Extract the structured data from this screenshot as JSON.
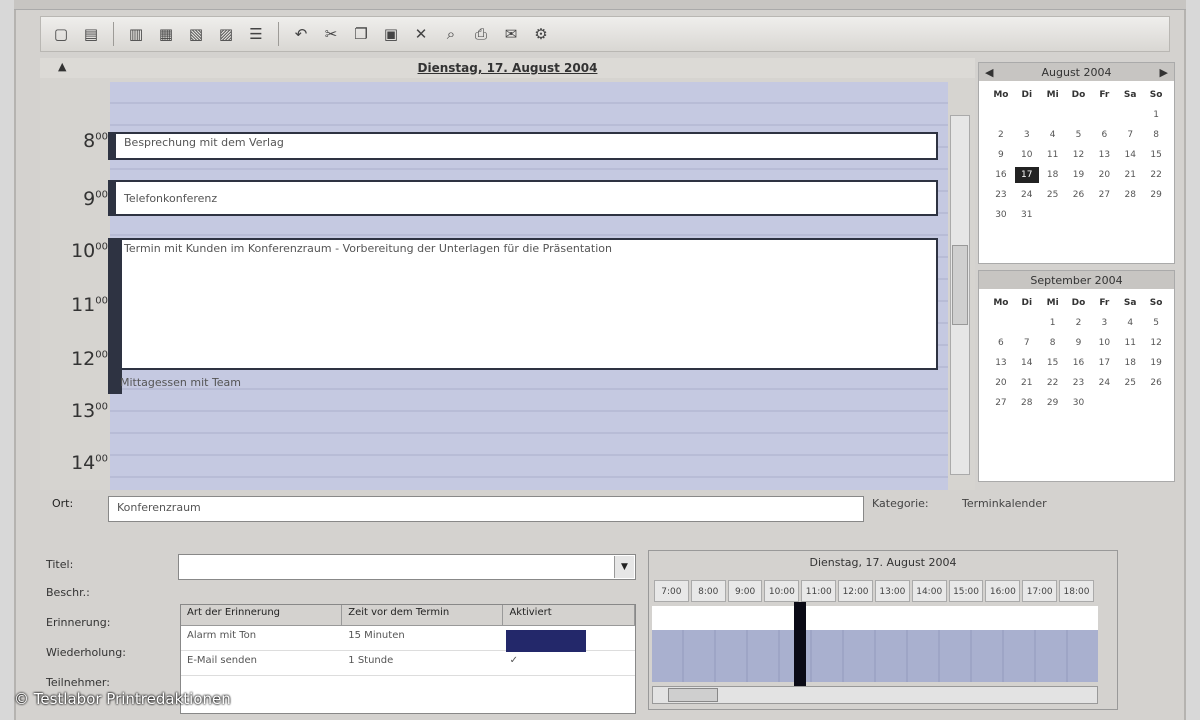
{
  "day_view": {
    "title": "Dienstag, 17. August 2004",
    "hours": [
      "8",
      "9",
      "10",
      "11",
      "12",
      "13",
      "14"
    ],
    "appointments": [
      "Besprechung mit dem Verlag",
      "Telefonkonferenz",
      "Termin mit Kunden im Konferenzraum - Vorbereitung der Unterlagen für die Präsentation",
      "Mittagessen mit Team"
    ]
  },
  "mini_cal_1": {
    "title": "August 2004",
    "weekdays": [
      "Mo",
      "Di",
      "Mi",
      "Do",
      "Fr",
      "Sa",
      "So"
    ],
    "days": [
      "",
      "",
      "",
      "",
      "",
      "",
      "1",
      "2",
      "3",
      "4",
      "5",
      "6",
      "7",
      "8",
      "9",
      "10",
      "11",
      "12",
      "13",
      "14",
      "15",
      "16",
      "17",
      "18",
      "19",
      "20",
      "21",
      "22",
      "23",
      "24",
      "25",
      "26",
      "27",
      "28",
      "29",
      "30",
      "31"
    ],
    "selected": "17"
  },
  "mini_cal_2": {
    "title": "September 2004",
    "weekdays": [
      "Mo",
      "Di",
      "Mi",
      "Do",
      "Fr",
      "Sa",
      "So"
    ],
    "days": [
      "",
      "",
      "1",
      "2",
      "3",
      "4",
      "5",
      "6",
      "7",
      "8",
      "9",
      "10",
      "11",
      "12",
      "13",
      "14",
      "15",
      "16",
      "17",
      "18",
      "19",
      "20",
      "21",
      "22",
      "23",
      "24",
      "25",
      "26",
      "27",
      "28",
      "29",
      "30"
    ]
  },
  "location": {
    "label": "Ort:",
    "value": "Konferenzraum",
    "category_label": "Kategorie:",
    "category_value": "Terminkalender"
  },
  "form": {
    "title_label": "Titel:",
    "description_label": "Beschr.:",
    "reminder_label": "Erinnerung:",
    "repeat_label": "Wiederholung:",
    "attendees_label": "Teilnehmer:",
    "reminder_table": {
      "headers": [
        "Art der Erinnerung",
        "Zeit vor dem Termin",
        "Aktiviert"
      ],
      "rows": [
        [
          "Alarm mit Ton",
          "15 Minuten",
          "✓"
        ],
        [
          "E-Mail senden",
          "1 Stunde",
          "✓"
        ]
      ]
    }
  },
  "scheduler": {
    "title": "Dienstag, 17. August 2004",
    "hours": [
      "7:00",
      "8:00",
      "9:00",
      "10:00",
      "11:00",
      "12:00",
      "13:00",
      "14:00",
      "15:00",
      "16:00",
      "17:00",
      "18:00"
    ],
    "busy_fraction_start": 0.33
  },
  "watermark": "© Testlabor Printredaktionen",
  "colors": {
    "grid_band": "#c5c9e1",
    "appointment_border": "#2e3342",
    "selection": "#23286a"
  }
}
